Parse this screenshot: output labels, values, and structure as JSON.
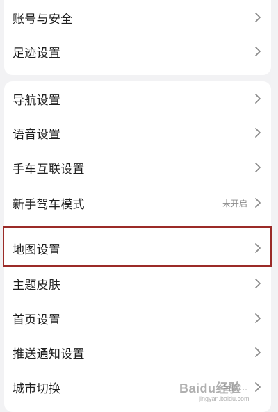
{
  "group1": [
    {
      "label": "账号与安全"
    },
    {
      "label": "足迹设置"
    }
  ],
  "group2": [
    {
      "label": "导航设置"
    },
    {
      "label": "语音设置"
    },
    {
      "label": "手车互联设置"
    },
    {
      "label": "新手驾车模式",
      "value": "未开启"
    },
    {
      "label": "地图设置"
    },
    {
      "label": "主题皮肤"
    },
    {
      "label": "首页设置"
    },
    {
      "label": "推送通知设置"
    },
    {
      "label": "城市切换",
      "value": "当前..."
    }
  ],
  "watermark": {
    "main": "Baidu经验",
    "sub": "jingyan.baidu.com"
  },
  "colors": {
    "highlight_border": "#9b2b28",
    "background": "#f2f2f4",
    "card": "#ffffff"
  },
  "icons": {
    "row_chevron": "chevron-right-icon"
  }
}
